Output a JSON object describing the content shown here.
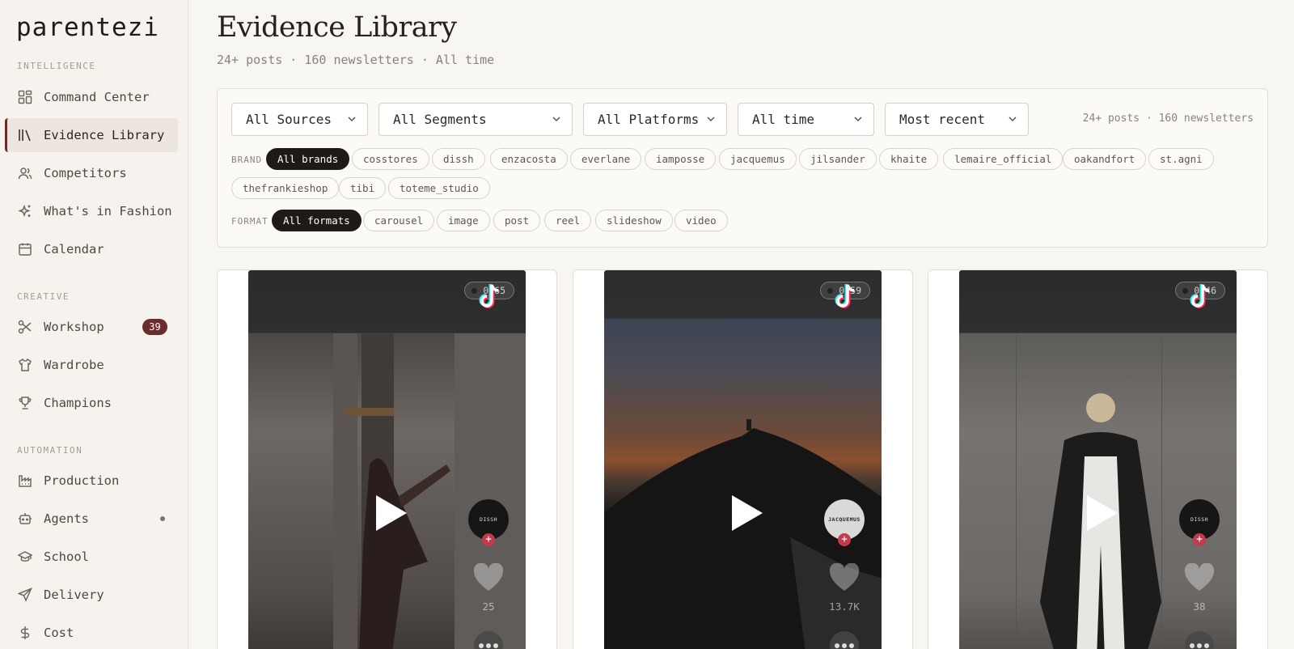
{
  "app": {
    "logo": "parentezi"
  },
  "sidebar": {
    "section_intelligence": "INTELLIGENCE",
    "section_creative": "CREATIVE",
    "section_automation": "AUTOMATION",
    "items": [
      {
        "label": "Command Center",
        "icon": "grid-icon"
      },
      {
        "label": "Evidence Library",
        "icon": "library-icon",
        "active": true
      },
      {
        "label": "Competitors",
        "icon": "users-icon"
      },
      {
        "label": "What's in Fashion",
        "icon": "sparkles-icon"
      },
      {
        "label": "Calendar",
        "icon": "calendar-icon"
      },
      {
        "label": "Workshop",
        "icon": "scissors-icon",
        "badge": "39"
      },
      {
        "label": "Wardrobe",
        "icon": "shirt-icon"
      },
      {
        "label": "Champions",
        "icon": "trophy-icon"
      },
      {
        "label": "Production",
        "icon": "factory-icon"
      },
      {
        "label": "Agents",
        "icon": "bot-icon"
      },
      {
        "label": "School",
        "icon": "graduation-cap-icon"
      },
      {
        "label": "Delivery",
        "icon": "send-icon"
      },
      {
        "label": "Cost",
        "icon": "dollar-icon"
      }
    ]
  },
  "header": {
    "title": "Evidence Library",
    "subtitle": "24+ posts · 160 newsletters · All time"
  },
  "filters": {
    "sources": "All Sources",
    "segments": "All Segments",
    "platforms": "All Platforms",
    "time": "All time",
    "sort": "Most recent",
    "counts": "24+ posts · 160 newsletters",
    "brand_label": "BRAND",
    "brands": [
      "All brands",
      "cosstores",
      "dissh",
      "enzacosta",
      "everlane",
      "iamposse",
      "jacquemus",
      "jilsander",
      "khaite",
      "lemaire_official",
      "oakandfort",
      "st.agni",
      "thefrankieshop",
      "tibi",
      "toteme_studio"
    ],
    "format_label": "FORMAT",
    "formats": [
      "All formats",
      "carousel",
      "image",
      "post",
      "reel",
      "slideshow",
      "video"
    ]
  },
  "cards": [
    {
      "score": "0.65",
      "platform": "tiktok-icon",
      "account": "DISSH",
      "likes": "25"
    },
    {
      "score": "0.59",
      "platform": "tiktok-icon",
      "account": "JACQUEMUS",
      "likes": "13.7K"
    },
    {
      "score": "0.46",
      "platform": "tiktok-icon",
      "account": "DISSH",
      "likes": "38"
    }
  ],
  "colors": {
    "accent": "#6b2c2c",
    "chip_active": "#1d1a18",
    "background": "#f8f6f2"
  }
}
